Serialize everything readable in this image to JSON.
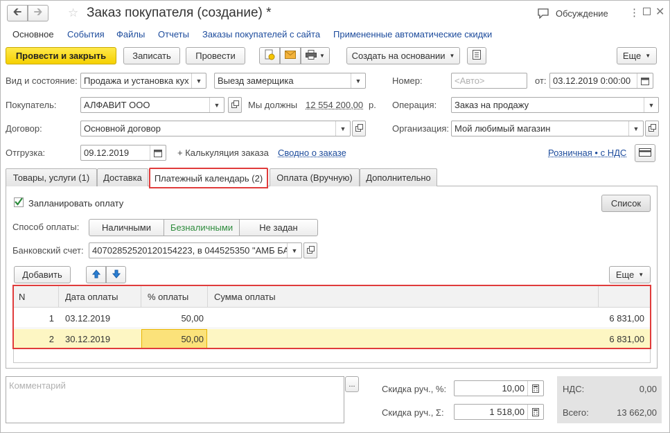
{
  "window": {
    "title": "Заказ покупателя (создание) *",
    "discussion": "Обсуждение"
  },
  "nav_links": [
    "Основное",
    "События",
    "Файлы",
    "Отчеты",
    "Заказы покупателей с сайта",
    "Примененные автоматические скидки"
  ],
  "toolbar": {
    "post_close": "Провести и закрыть",
    "save": "Записать",
    "post": "Провести",
    "create_based": "Создать на основании",
    "more": "Еще"
  },
  "header": {
    "state_label": "Вид и состояние:",
    "state_value1": "Продажа и установка кух",
    "state_value2": "Выезд замерщика",
    "number_label": "Номер:",
    "number_placeholder": "<Авто>",
    "from_label": "от:",
    "date_value": "03.12.2019  0:00:00",
    "buyer_label": "Покупатель:",
    "buyer_value": "АЛФАВИТ ООО",
    "owe_text": "Мы должны",
    "owe_amount": "12 554 200,00",
    "owe_currency": "р.",
    "operation_label": "Операция:",
    "operation_value": "Заказ на продажу",
    "contract_label": "Договор:",
    "contract_value": "Основной договор",
    "org_label": "Организация:",
    "org_value": "Мой любимый магазин",
    "shipment_label": "Отгрузка:",
    "shipment_value": "09.12.2019",
    "calc_text": "+ Калькуляция заказа",
    "summary_link": "Сводно о заказе",
    "retail_link": "Розничная • с НДС"
  },
  "tabs": [
    "Товары, услуги (1)",
    "Доставка",
    "Платежный календарь (2)",
    "Оплата (Вручную)",
    "Дополнительно"
  ],
  "payment": {
    "plan_checkbox": "Запланировать оплату",
    "list_button": "Список",
    "method_label": "Способ оплаты:",
    "methods": [
      "Наличными",
      "Безналичными",
      "Не задан"
    ],
    "account_label": "Банковский счет:",
    "account_value": "40702852520120154223, в 044525350 \"АМБ БА",
    "add_button": "Добавить",
    "more_button": "Еще"
  },
  "table": {
    "columns": [
      "N",
      "Дата оплаты",
      "% оплаты",
      "Сумма оплаты"
    ],
    "rows": [
      {
        "n": "1",
        "date": "03.12.2019",
        "percent": "50,00",
        "sum": "6 831,00"
      },
      {
        "n": "2",
        "date": "30.12.2019",
        "percent": "50,00",
        "sum": "6 831,00"
      }
    ]
  },
  "footer": {
    "comment_placeholder": "Комментарий",
    "discount_pct_label": "Скидка руч., %:",
    "discount_pct_value": "10,00",
    "discount_sum_label": "Скидка руч., Σ:",
    "discount_sum_value": "1 518,00",
    "vat_label": "НДС:",
    "vat_value": "0,00",
    "total_label": "Всего:",
    "total_value": "13 662,00"
  },
  "colors": {
    "primary_button": "#f5d000",
    "link": "#1c4b9c",
    "highlight_border": "#e03b3b",
    "selected_row": "#fdf6c3",
    "active_method": "#2e8b3d"
  }
}
